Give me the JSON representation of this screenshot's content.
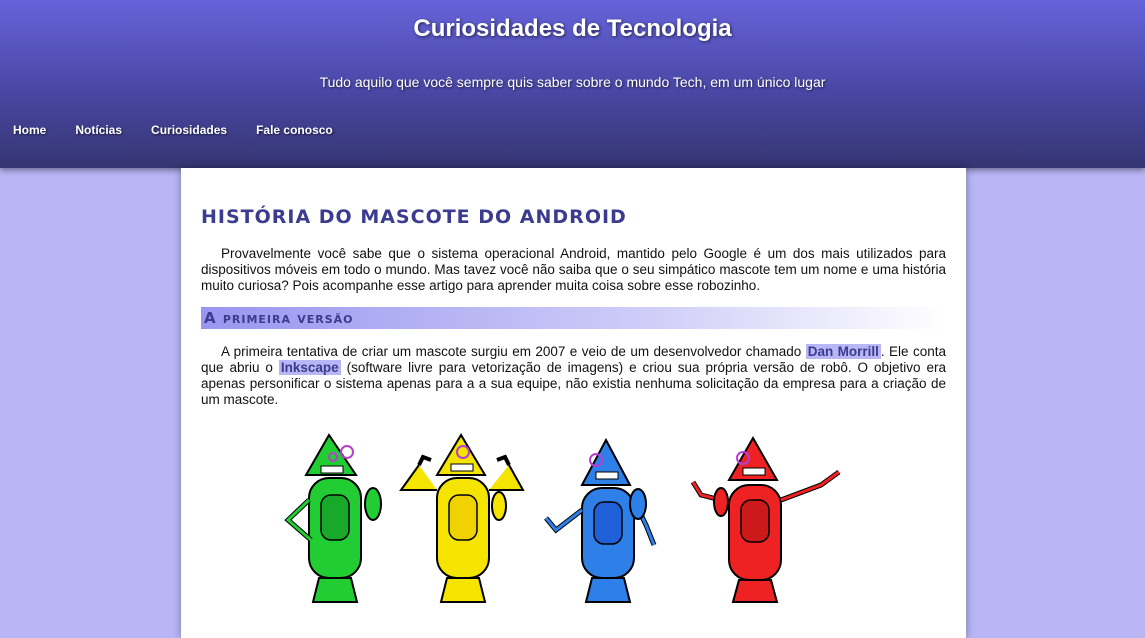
{
  "header": {
    "title": "Curiosidades de Tecnologia",
    "subtitle": "Tudo aquilo que você sempre quis saber sobre o mundo Tech, em um único lugar"
  },
  "nav": {
    "items": [
      {
        "label": "Home"
      },
      {
        "label": "Notícias"
      },
      {
        "label": "Curiosidades"
      },
      {
        "label": "Fale conosco"
      }
    ]
  },
  "article": {
    "title": "História do mascote do Android",
    "intro": "Provavelmente você sabe que o sistema operacional Android, mantido pelo Google é um dos mais utilizados para dispositivos móveis em todo o mundo. Mas tavez você não saiba que o seu simpático mascote tem um nome e uma história muito curiosa? Pois acompanhe esse artigo para aprender muita coisa sobre esse robozinho.",
    "section_title": "A primeira versão",
    "p2_part1": "A primeira tentativa de criar um mascote surgiu em 2007 e veio de um desenvolvedor chamado ",
    "p2_highlight1": "Dan Morrill",
    "p2_part2": ". Ele conta que abriu o ",
    "p2_highlight2": "Inkscape",
    "p2_part3": " (software livre para vetorização de imagens) e criou sua própria versão de robô. O objetivo era apenas personificar o sistema apenas para a a sua equipe, não existia nenhuma solicitação da empresa para a criação de um mascote."
  },
  "colors": {
    "header_top": "#6663da",
    "header_bottom": "#353573",
    "page_bg": "#b8b6f5",
    "accent_text": "#3b3b8f",
    "robot_green": "#22cc33",
    "robot_yellow": "#f5e400",
    "robot_blue": "#2f7fe8",
    "robot_red": "#ee2222"
  }
}
